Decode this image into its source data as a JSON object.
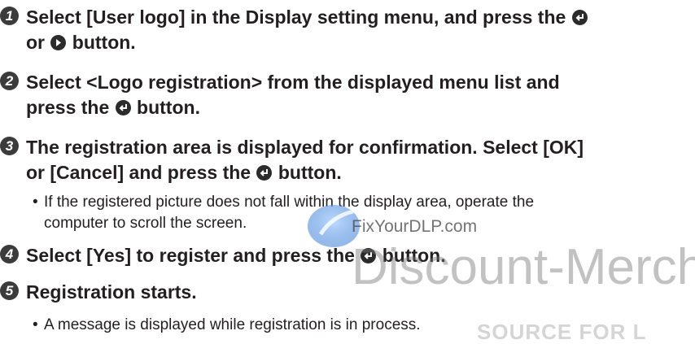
{
  "steps": [
    {
      "number": "1",
      "parts": [
        "Select [User logo] in the Display setting menu, and press the ",
        "enter",
        " or ",
        "right",
        " button."
      ]
    },
    {
      "number": "2",
      "parts": [
        "Select <Logo registration> from the displayed menu list and press the ",
        "enter",
        " button."
      ]
    },
    {
      "number": "3",
      "parts": [
        "The registration area is displayed for confirmation. Select [OK] or [Cancel] and press the ",
        "enter",
        " button."
      ]
    },
    {
      "number": "4",
      "parts": [
        "Select [Yes] to register and press the ",
        "enter",
        " button."
      ]
    },
    {
      "number": "5",
      "parts": [
        "Registration starts."
      ]
    }
  ],
  "step1": {
    "num": "1",
    "t1": "Select [User logo] in the Display setting menu, and press the",
    "t2": "or",
    "t3": "button."
  },
  "step2": {
    "num": "2",
    "t1": "Select <Logo registration> from the displayed menu list and",
    "t2": "press the",
    "t3": "button."
  },
  "step3": {
    "num": "3",
    "t1": "The registration area is displayed for confirmation. Select [OK]",
    "t2": "or [Cancel] and press the",
    "t3": "button."
  },
  "step4": {
    "num": "4",
    "t1": "Select [Yes] to register and press the",
    "t2": "button."
  },
  "step5": {
    "num": "5",
    "t1": "Registration starts."
  },
  "notes": {
    "bullet_symbol": "•",
    "note3_line1": "If the registered picture does not fall within the display area, operate the",
    "note3_line2": "computer to scroll the screen.",
    "note5": "A message is displayed while registration is in process."
  },
  "watermark": {
    "site": "FixYourDLP.com",
    "brand": "Discount-Mercha",
    "tagline": "SOURCE FOR L"
  },
  "icons": {
    "enter_button": "enter-button-icon",
    "right_button": "right-arrow-button-icon"
  },
  "colors": {
    "text": "#231f20",
    "icon": "#2b2b2b",
    "watermark": "#8a8a8a",
    "logo_blue": "#3d7fd6"
  }
}
